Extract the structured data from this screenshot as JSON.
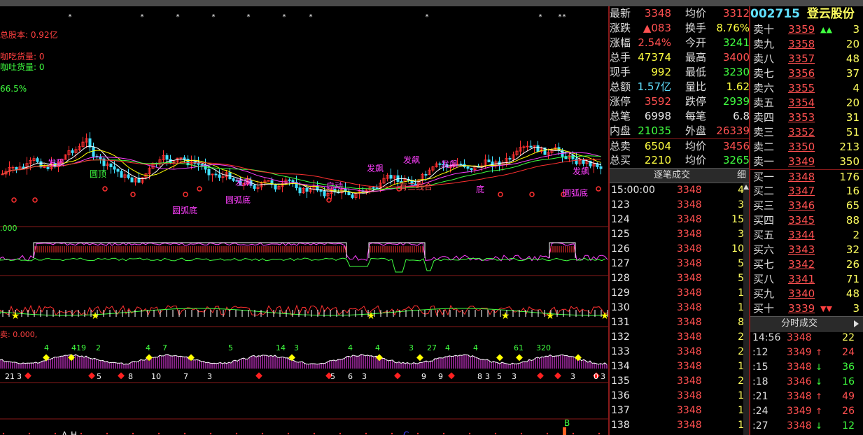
{
  "overlays": {
    "total_shares": "总股本: 0.92亿",
    "line_absorb": "咖吃货量: 0",
    "line_spit": "咖吐货量: 0",
    "percent": "66.5%",
    "ind1_label": ".000",
    "ind3_label": "卖: 0.000,",
    "colors": {
      "red": "#ff3030",
      "green": "#40ff40",
      "magenta": "#ff40ff",
      "yellow": "#ffff00",
      "white": "#ffffff"
    }
  },
  "chart_labels": {
    "main": [
      "发飙",
      "圆顶",
      "发飙",
      "圆弧底",
      "发飙",
      "发飙",
      "发飙",
      "发飙",
      "圆弧底",
      "启动",
      "圆弧底",
      "有三线合",
      "底"
    ],
    "ind3_numbers": [
      "4",
      "419",
      "2",
      "4",
      "7",
      "5",
      "14",
      "3",
      "4",
      "4",
      "3",
      "27",
      "4",
      "4",
      "61",
      "320",
      "3",
      "0",
      "21",
      "3",
      "5",
      "8",
      "10",
      "7",
      "3",
      "5",
      "6",
      "3",
      "9",
      "9",
      "8",
      "3",
      "5",
      "3",
      "3"
    ],
    "bottom_letters": [
      "A",
      "H",
      "C",
      "B"
    ]
  },
  "quote": {
    "rows": [
      {
        "l": "最新",
        "v": "3348",
        "vc": "red",
        "l2": "均价",
        "v2": "3312",
        "v2c": "red"
      },
      {
        "l": "涨跌",
        "v": "▲083",
        "vc": "red",
        "l2": "换手",
        "v2": "8.76%",
        "v2c": "yellow"
      },
      {
        "l": "涨幅",
        "v": "2.54%",
        "vc": "red",
        "l2": "今开",
        "v2": "3241",
        "v2c": "green"
      },
      {
        "l": "总手",
        "v": "47374",
        "vc": "yellow",
        "l2": "最高",
        "v2": "3400",
        "v2c": "red"
      },
      {
        "l": "现手",
        "v": "992",
        "vc": "yellow",
        "l2": "最低",
        "v2": "3230",
        "v2c": "green"
      },
      {
        "l": "总额",
        "v": "1.57亿",
        "vc": "cyan",
        "l2": "量比",
        "v2": "1.62",
        "v2c": "yellow"
      },
      {
        "l": "涨停",
        "v": "3592",
        "vc": "red",
        "l2": "跌停",
        "v2": "2939",
        "v2c": "green"
      },
      {
        "l": "总笔",
        "v": "6998",
        "vc": "white",
        "l2": "每笔",
        "v2": "6.8",
        "v2c": "white"
      },
      {
        "l": "内盘",
        "v": "21035",
        "vc": "green",
        "l2": "外盘",
        "v2": "26339",
        "v2c": "red"
      },
      {
        "l": "总卖",
        "v": "6504",
        "vc": "yellow",
        "l2": "均价",
        "v2": "3456",
        "v2c": "red"
      },
      {
        "l": "总买",
        "v": "2210",
        "vc": "yellow",
        "l2": "均价",
        "v2": "3265",
        "v2c": "green"
      }
    ]
  },
  "stock": {
    "code": "002715",
    "name": "登云股份"
  },
  "book": {
    "sell": [
      {
        "l": "卖十",
        "p": "3359",
        "v": "3",
        "arrow": "▲▲"
      },
      {
        "l": "卖九",
        "p": "3358",
        "v": "20"
      },
      {
        "l": "卖八",
        "p": "3357",
        "v": "48"
      },
      {
        "l": "卖七",
        "p": "3356",
        "v": "37"
      },
      {
        "l": "卖六",
        "p": "3355",
        "v": "4"
      },
      {
        "l": "卖五",
        "p": "3354",
        "v": "20"
      },
      {
        "l": "卖四",
        "p": "3353",
        "v": "31"
      },
      {
        "l": "卖三",
        "p": "3352",
        "v": "51"
      },
      {
        "l": "卖二",
        "p": "3350",
        "v": "213"
      },
      {
        "l": "卖一",
        "p": "3349",
        "v": "350"
      }
    ],
    "buy": [
      {
        "l": "买一",
        "p": "3348",
        "v": "176"
      },
      {
        "l": "买二",
        "p": "3347",
        "v": "16"
      },
      {
        "l": "买三",
        "p": "3346",
        "v": "65"
      },
      {
        "l": "买四",
        "p": "3345",
        "v": "88"
      },
      {
        "l": "买五",
        "p": "3344",
        "v": "2"
      },
      {
        "l": "买六",
        "p": "3343",
        "v": "32"
      },
      {
        "l": "买七",
        "p": "3342",
        "v": "26"
      },
      {
        "l": "买八",
        "p": "3341",
        "v": "71"
      },
      {
        "l": "买九",
        "p": "3340",
        "v": "48"
      },
      {
        "l": "买十",
        "p": "3339",
        "v": "3",
        "arrow": "▼▼"
      }
    ]
  },
  "ticks": {
    "title": "逐笔成交",
    "detail": "细",
    "rows": [
      {
        "t": "15:00:00",
        "p": "3348",
        "v": "4"
      },
      {
        "t": "123",
        "p": "3348",
        "v": "3"
      },
      {
        "t": "124",
        "p": "3348",
        "v": "15"
      },
      {
        "t": "125",
        "p": "3348",
        "v": "3"
      },
      {
        "t": "126",
        "p": "3348",
        "v": "10"
      },
      {
        "t": "127",
        "p": "3348",
        "v": "5"
      },
      {
        "t": "128",
        "p": "3348",
        "v": "5"
      },
      {
        "t": "129",
        "p": "3348",
        "v": "1"
      },
      {
        "t": "130",
        "p": "3348",
        "v": "1"
      },
      {
        "t": "131",
        "p": "3348",
        "v": "8"
      },
      {
        "t": "132",
        "p": "3348",
        "v": "2"
      },
      {
        "t": "133",
        "p": "3348",
        "v": "2"
      },
      {
        "t": "134",
        "p": "3348",
        "v": "1"
      },
      {
        "t": "135",
        "p": "3348",
        "v": "2"
      },
      {
        "t": "136",
        "p": "3348",
        "v": "1"
      },
      {
        "t": "137",
        "p": "3348",
        "v": "1"
      },
      {
        "t": "138",
        "p": "3348",
        "v": "1"
      }
    ]
  },
  "minute": {
    "title": "分时成交",
    "rows": [
      {
        "t": "14:56",
        "p": "3348",
        "a": "",
        "v": "22",
        "vc": "yellow"
      },
      {
        "t": ":12",
        "p": "3349",
        "a": "up",
        "v": "24",
        "vc": "red"
      },
      {
        "t": ":15",
        "p": "3348",
        "a": "down",
        "v": "36",
        "vc": "green"
      },
      {
        "t": ":18",
        "p": "3346",
        "a": "down",
        "v": "16",
        "vc": "green"
      },
      {
        "t": ":21",
        "p": "3348",
        "a": "up",
        "v": "49",
        "vc": "red"
      },
      {
        "t": ":24",
        "p": "3349",
        "a": "up",
        "v": "26",
        "vc": "red"
      },
      {
        "t": ":27",
        "p": "3348",
        "a": "down",
        "v": "12",
        "vc": "green"
      }
    ]
  },
  "icons": {
    "sell_up": "double-up-arrow-icon",
    "buy_down": "double-down-arrow-icon",
    "up": "up-arrow-icon",
    "down": "down-arrow-icon",
    "play": "play-triangle-icon"
  }
}
